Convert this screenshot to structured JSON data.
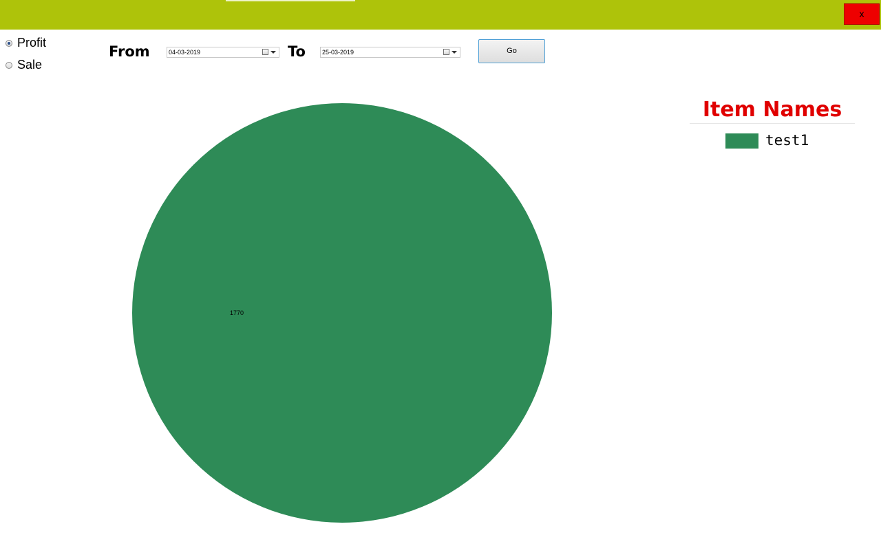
{
  "window": {
    "close_label": "x",
    "title_bar_color": "#aec30a",
    "close_color": "#ee0000"
  },
  "report_type": {
    "options": [
      {
        "label": "Profit",
        "checked": true
      },
      {
        "label": "Sale",
        "checked": false
      }
    ]
  },
  "date_range": {
    "from_label": "From",
    "from_value": "04-03-2019",
    "to_label": "To",
    "to_value": "25-03-2019",
    "calendar_icon": "calendar-dropdown-icon",
    "go_label": "Go"
  },
  "chart_data": {
    "type": "pie",
    "slices": [
      {
        "label": "test1",
        "value": 1770,
        "color": "#2e8b57"
      }
    ],
    "data_labels": [
      "1770"
    ],
    "legend": {
      "title": "Item Names",
      "title_color": "#e00000",
      "position": "top-right",
      "entries": [
        "test1"
      ]
    }
  }
}
